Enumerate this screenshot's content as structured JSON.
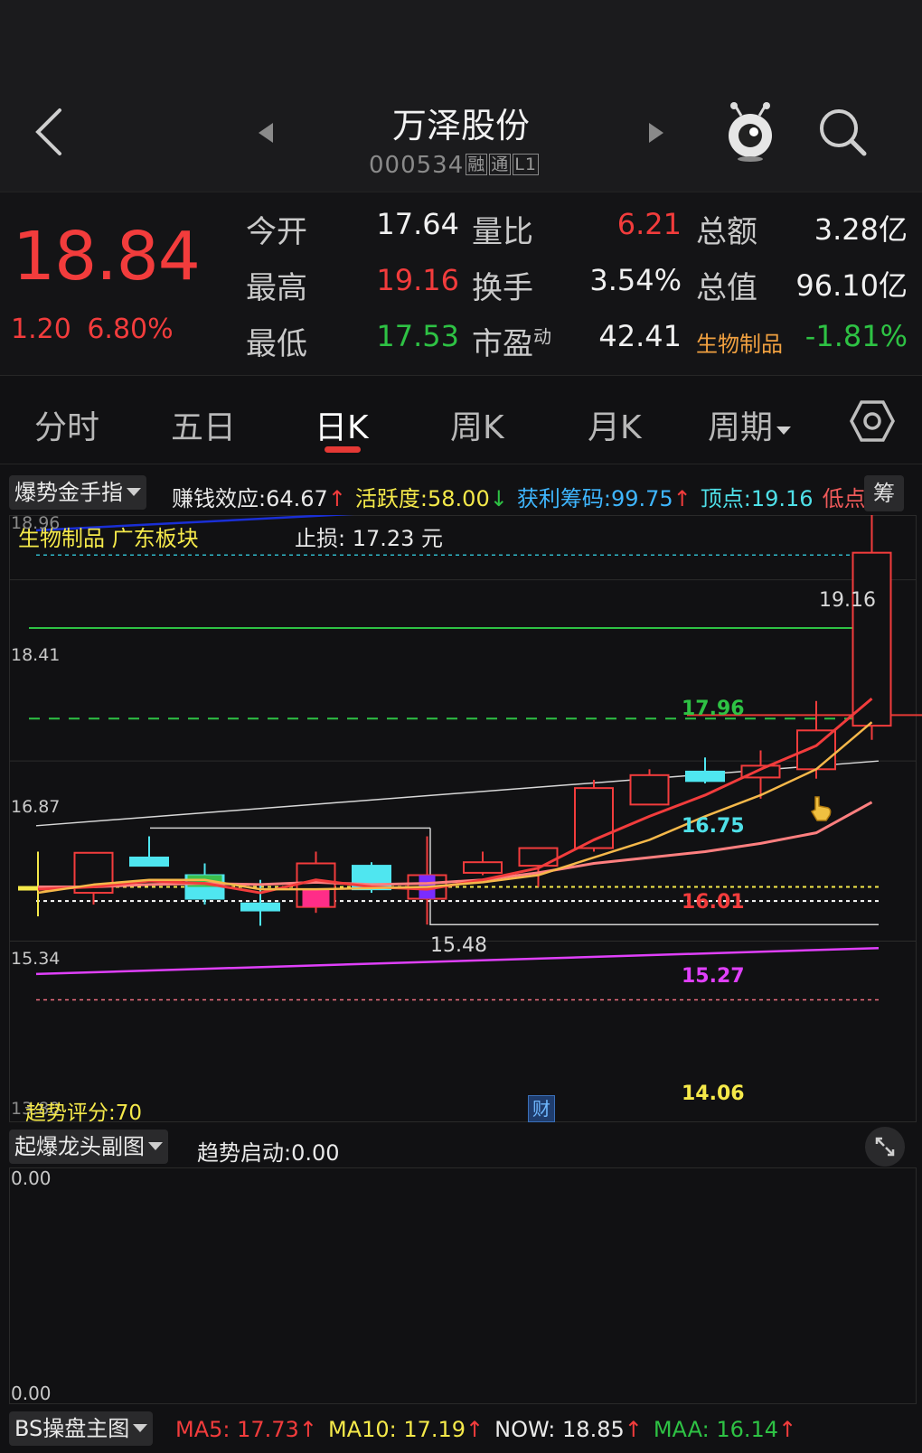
{
  "header": {
    "title": "万泽股份",
    "code": "000534",
    "tags": [
      "融",
      "通",
      "L1"
    ]
  },
  "quote": {
    "price": "18.84",
    "change": "1.20",
    "change_pct": "6.80%",
    "rows": [
      {
        "l1": "今开",
        "v1": "17.64",
        "c1": "#f0f0f0",
        "l2": "量比",
        "v2": "6.21",
        "c2": "#f23c3c",
        "l3": "总额",
        "v3": "3.28亿",
        "c3": "#f0f0f0"
      },
      {
        "l1": "最高",
        "v1": "19.16",
        "c1": "#f23c3c",
        "l2": "换手",
        "v2": "3.54%",
        "c2": "#f0f0f0",
        "l3": "总值",
        "v3": "96.10亿",
        "c3": "#f0f0f0"
      },
      {
        "l1": "最低",
        "v1": "17.53",
        "c1": "#2ec244",
        "l2": "市盈",
        "v2": "42.41",
        "c2": "#f0f0f0",
        "l3": "生物制品",
        "v3": "-1.81%",
        "c3": "#2ec244"
      }
    ],
    "pe_superscript": "动"
  },
  "tabs": [
    {
      "label": "分时"
    },
    {
      "label": "五日"
    },
    {
      "label": "日K"
    },
    {
      "label": "周K"
    },
    {
      "label": "月K"
    },
    {
      "label": "周期"
    }
  ],
  "main_indicator": {
    "selector": "爆势金手指",
    "items": [
      {
        "label": "赚钱效应:",
        "value": "64.67",
        "arrow": "↑",
        "lc": "#e8e8e8",
        "vc": "#e8e8e8",
        "ac": "#f23c3c"
      },
      {
        "label": "活跃度:",
        "value": "58.00",
        "arrow": "↓",
        "lc": "#f5e94a",
        "vc": "#f5e94a",
        "ac": "#2ec244"
      },
      {
        "label": "获利筹码:",
        "value": "99.75",
        "arrow": "↑",
        "lc": "#3fb6ff",
        "vc": "#3fb6ff",
        "ac": "#f23c3c"
      },
      {
        "label": "顶点:",
        "value": "19.16",
        "arrow": "",
        "lc": "#4fe0e8",
        "vc": "#4fe0e8",
        "ac": "#f23c3c"
      },
      {
        "label": "低点",
        "value": "",
        "arrow": "",
        "lc": "#ef5a5a",
        "vc": "#ef5a5a",
        "ac": "#ef5a5a"
      }
    ],
    "chip_button": "筹"
  },
  "chart_labels": {
    "sector": "生物制品 广东板块",
    "stop_loss": "止损: 17.23 元",
    "y_top": "18.96",
    "y_mid1": "18.41",
    "y_mid2": "16.87",
    "y_mid3": "15.34",
    "y_bottom": "13.80",
    "high": "19.16",
    "level_1796": "17.96",
    "level_1675": "16.75",
    "level_1601": "16.01",
    "level_1527": "15.27",
    "low_1548": "15.48",
    "level_1406": "14.06",
    "trend_score": "趋势评分:70",
    "finance_badge": "财"
  },
  "chart_data": {
    "type": "candlestick",
    "ylim": [
      13.8,
      18.96
    ],
    "candles": [
      {
        "o": 15.8,
        "c": 15.78,
        "h": 16.1,
        "l": 15.55,
        "color": "#f5e94a"
      },
      {
        "o": 15.75,
        "c": 16.09,
        "h": 16.09,
        "l": 15.65,
        "color": "#f23c3c"
      },
      {
        "o": 15.98,
        "c": 16.05,
        "h": 16.23,
        "l": 15.98,
        "color": "#4fe6f0"
      },
      {
        "o": 15.9,
        "c": 15.7,
        "h": 16.0,
        "l": 15.65,
        "color": "#4fe6f0"
      },
      {
        "o": 15.66,
        "c": 15.6,
        "h": 15.86,
        "l": 15.47,
        "color": "#4fe6f0"
      },
      {
        "o": 15.63,
        "c": 16.0,
        "h": 16.1,
        "l": 15.58,
        "color": "#f23c3c"
      },
      {
        "o": 15.98,
        "c": 15.78,
        "h": 16.01,
        "l": 15.75,
        "color": "#4fe6f0"
      },
      {
        "o": 15.7,
        "c": 15.9,
        "h": 16.23,
        "l": 15.48,
        "color": "#f23c3c"
      },
      {
        "o": 15.92,
        "c": 16.01,
        "h": 16.1,
        "l": 15.9,
        "color": "#f23c3c"
      },
      {
        "o": 15.98,
        "c": 16.13,
        "h": 16.13,
        "l": 15.8,
        "color": "#f23c3c"
      },
      {
        "o": 16.13,
        "c": 16.64,
        "h": 16.71,
        "l": 16.1,
        "color": "#f23c3c"
      },
      {
        "o": 16.5,
        "c": 16.75,
        "h": 16.8,
        "l": 16.5,
        "color": "#f23c3c"
      },
      {
        "o": 16.78,
        "c": 16.7,
        "h": 16.9,
        "l": 16.68,
        "color": "#4fe6f0"
      },
      {
        "o": 16.73,
        "c": 16.83,
        "h": 16.96,
        "l": 16.55,
        "color": "#f23c3c"
      },
      {
        "o": 16.8,
        "c": 17.13,
        "h": 17.38,
        "l": 16.72,
        "color": "#f23c3c"
      },
      {
        "o": 17.17,
        "c": 18.64,
        "h": 19.16,
        "l": 17.05,
        "color": "#f23c3c"
      }
    ],
    "indicator_values": {
      "MA5": "17.73",
      "MA10": "17.19",
      "NOW": "18.85",
      "MAA": "16.14"
    }
  },
  "sub_indicator": {
    "selector": "起爆龙头副图",
    "label": "趋势启动:",
    "value": "0.00",
    "y_top": "0.00",
    "y_bottom": "0.00"
  },
  "bottom_indicator": {
    "selector": "BS操盘主图",
    "items": [
      {
        "label": "MA5:",
        "value": "17.73",
        "arrow": "↑",
        "color": "#f23c3c"
      },
      {
        "label": "MA10:",
        "value": "17.19",
        "arrow": "↑",
        "color": "#f5e94a"
      },
      {
        "label": "NOW:",
        "value": "18.85",
        "arrow": "↑",
        "color": "#eaeaea"
      },
      {
        "label": "MAA:",
        "value": "16.14",
        "arrow": "↑",
        "color": "#2ec244"
      }
    ]
  }
}
